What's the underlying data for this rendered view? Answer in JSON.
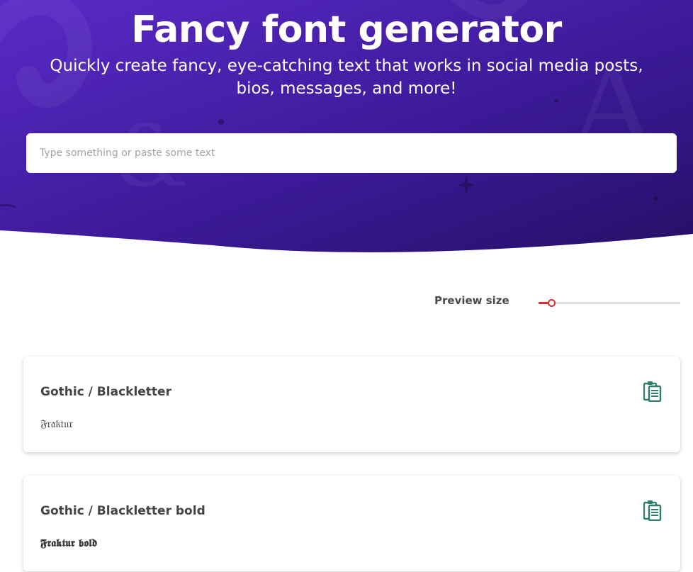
{
  "hero": {
    "title": "Fancy font generator",
    "subtitle": "Quickly create fancy, eye-catching text that works in social media posts, bios, messages, and more!",
    "input_placeholder": "Type something or paste some text",
    "input_value": "",
    "colors": {
      "gradient_start": "#5a2ac7",
      "gradient_end": "#2a1170"
    }
  },
  "preview": {
    "label": "Preview size",
    "slider_level": 0.09,
    "accent_color": "#d3302f"
  },
  "cards": [
    {
      "title": "Gothic / Blackletter",
      "preview_text": "𝔉𝔯𝔞𝔨𝔱𝔲𝔯",
      "copy_icon": "clipboard-icon"
    },
    {
      "title": "Gothic / Blackletter bold",
      "preview_text": "𝕱𝖗𝖆𝖐𝖙𝖚𝖗 𝖇𝖔𝖑𝖉",
      "copy_icon": "clipboard-icon"
    }
  ],
  "icon_color": "#2e7d6d"
}
